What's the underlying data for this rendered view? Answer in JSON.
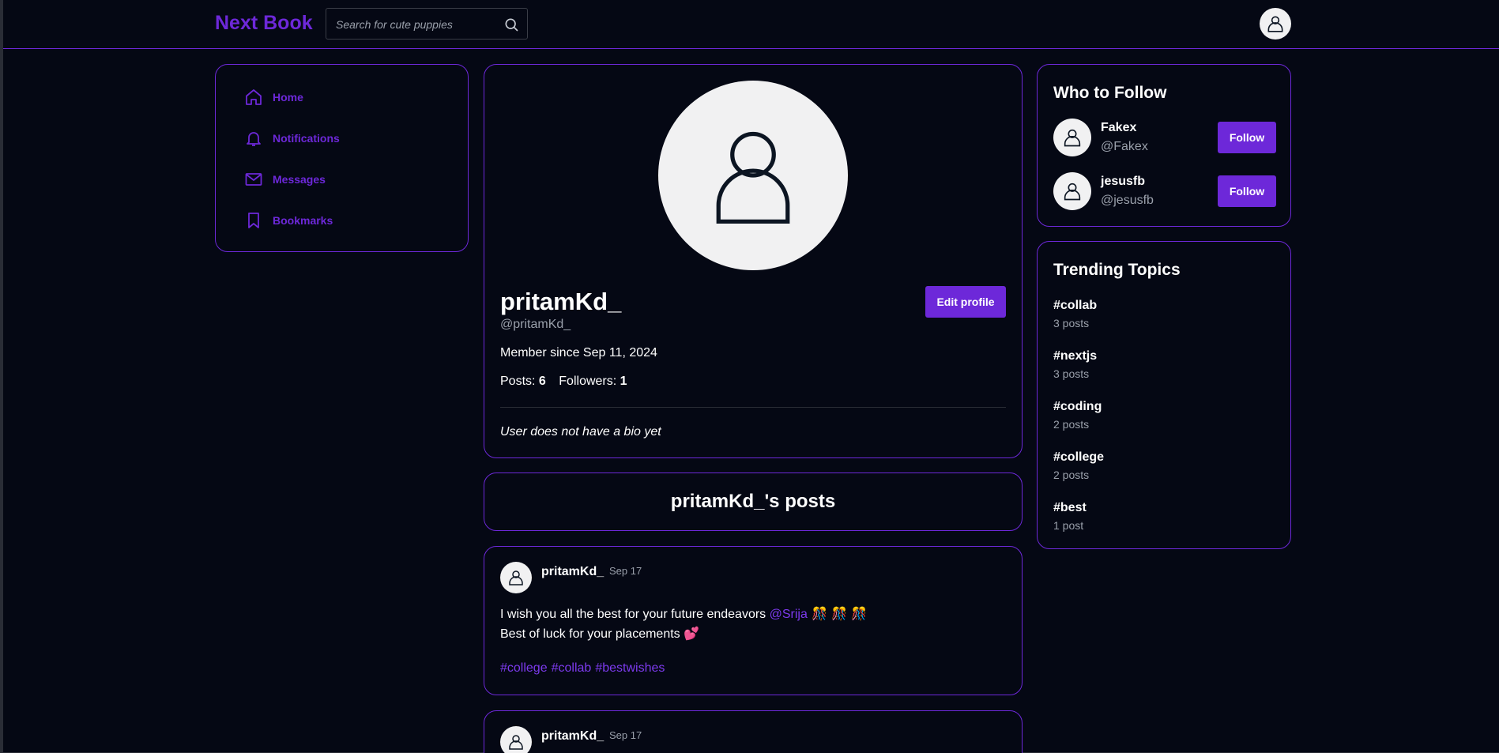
{
  "app": {
    "title": "Next Book"
  },
  "search": {
    "placeholder": "Search for cute puppies"
  },
  "nav": {
    "items": [
      {
        "label": "Home",
        "icon": "home-icon"
      },
      {
        "label": "Notifications",
        "icon": "bell-icon"
      },
      {
        "label": "Messages",
        "icon": "mail-icon"
      },
      {
        "label": "Bookmarks",
        "icon": "bookmark-icon"
      }
    ]
  },
  "profile": {
    "name": "pritamKd_",
    "handle": "@pritamKd_",
    "edit_label": "Edit profile",
    "member_since": "Member since Sep 11, 2024",
    "posts_label": "Posts:",
    "posts_count": "6",
    "followers_label": "Followers:",
    "followers_count": "1",
    "bio": "User does not have a bio yet"
  },
  "posts_section": {
    "title": "pritamKd_'s posts"
  },
  "posts": [
    {
      "author": "pritamKd_",
      "date": "Sep 17",
      "line1_text": "I wish you all the best for your future endeavors ",
      "mention": "@Srija",
      "line1_emoji": " 🎊 🎊 🎊",
      "line2_text": "Best of luck for your placements ",
      "line2_emoji": "💕",
      "tags": [
        "#college",
        "#collab",
        "#bestwishes"
      ]
    },
    {
      "author": "pritamKd_",
      "date": "Sep 17"
    }
  ],
  "who_to_follow": {
    "title": "Who to Follow",
    "users": [
      {
        "name": "Fakex",
        "handle": "@Fakex",
        "button": "Follow"
      },
      {
        "name": "jesusfb",
        "handle": "@jesusfb",
        "button": "Follow"
      }
    ]
  },
  "trending": {
    "title": "Trending Topics",
    "topics": [
      {
        "tag": "#collab",
        "count": "3 posts"
      },
      {
        "tag": "#nextjs",
        "count": "3 posts"
      },
      {
        "tag": "#coding",
        "count": "2 posts"
      },
      {
        "tag": "#college",
        "count": "2 posts"
      },
      {
        "tag": "#best",
        "count": "1 post"
      }
    ]
  },
  "colors": {
    "accent": "#6d28d9",
    "background": "#050814",
    "muted_text": "#9aa0ab",
    "avatar_bg": "#f1f1f2"
  }
}
